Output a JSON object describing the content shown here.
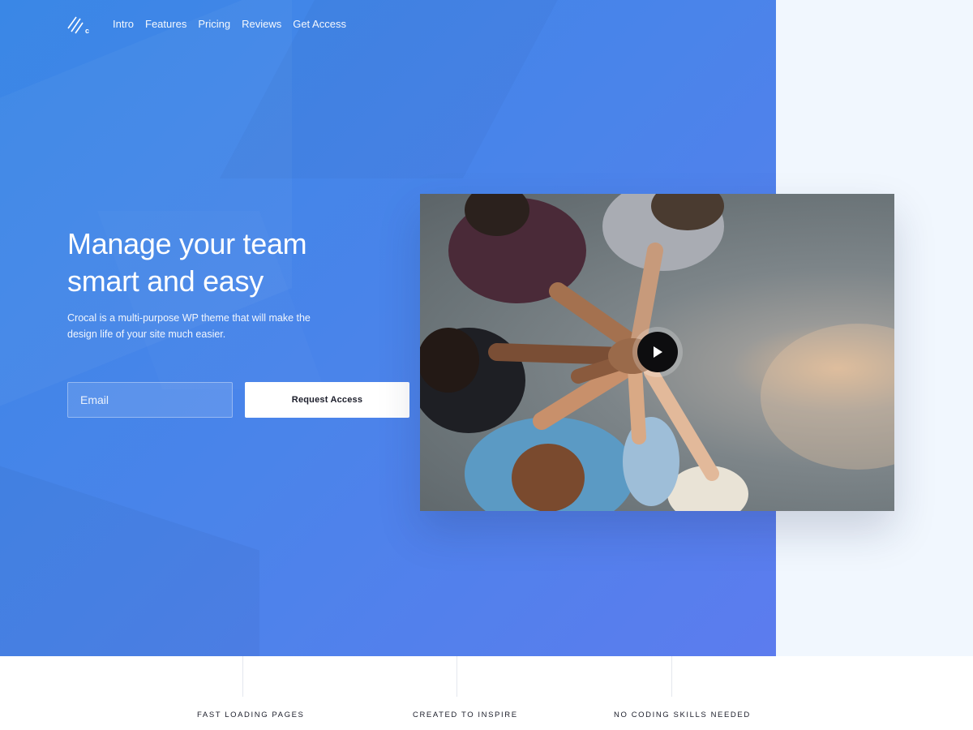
{
  "brand": {
    "logo_icon": "crocal-logo-icon",
    "logo_letter": "c"
  },
  "nav": {
    "items": [
      {
        "label": "Intro"
      },
      {
        "label": "Features"
      },
      {
        "label": "Pricing"
      },
      {
        "label": "Reviews"
      },
      {
        "label": "Get Access"
      }
    ]
  },
  "hero": {
    "headline_line1": "Manage your team",
    "headline_line2": "smart and easy",
    "description": "Crocal is a multi-purpose WP theme that will make the design life of your site much easier.",
    "email_placeholder": "Email",
    "email_value": "",
    "cta_label": "Request Access"
  },
  "video": {
    "play_icon": "play-icon"
  },
  "features": [
    {
      "label": "FAST LOADING PAGES"
    },
    {
      "label": "CREATED TO INSPIRE"
    },
    {
      "label": "NO CODING SKILLS NEEDED"
    }
  ],
  "colors": {
    "hero_gradient_start": "#3a87e6",
    "hero_gradient_end": "#5c7cee",
    "side_panel": "#f1f7fe",
    "cta_text": "#1b1d2a"
  }
}
